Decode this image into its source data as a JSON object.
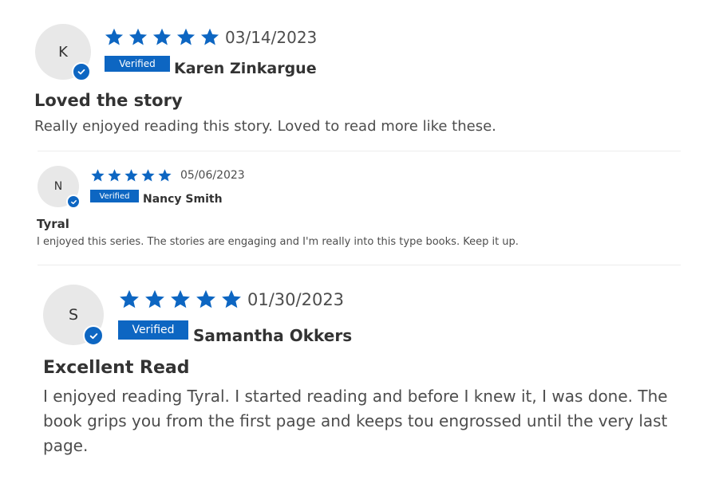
{
  "colors": {
    "accent": "#0d66c2",
    "avatar_bg": "#e8e8e8",
    "text": "#333333",
    "muted_text": "#4d4d4d",
    "divider": "#ececec"
  },
  "reviews": [
    {
      "avatar_initial": "K",
      "rating": 5,
      "max_rating": 5,
      "date": "03/14/2023",
      "verified_label": "Verified",
      "reviewer_name": "Karen Zinkargue",
      "title": "Loved the story",
      "body": "Really enjoyed reading this story. Loved to read more like these."
    },
    {
      "avatar_initial": "N",
      "rating": 5,
      "max_rating": 5,
      "date": "05/06/2023",
      "verified_label": "Verified",
      "reviewer_name": "Nancy Smith",
      "title": "Tyral",
      "body": "I enjoyed this series. The stories are engaging and I'm really into this type books. Keep it up."
    },
    {
      "avatar_initial": "S",
      "rating": 5,
      "max_rating": 5,
      "date": "01/30/2023",
      "verified_label": "Verified",
      "reviewer_name": "Samantha Okkers",
      "title": "Excellent Read",
      "body": "I enjoyed reading Tyral. I started reading and before I knew it, I was done. The book grips you from the first page and keeps tou engrossed until the very last page."
    }
  ],
  "icons": {
    "star": "star-icon",
    "verified_check": "check-icon"
  }
}
